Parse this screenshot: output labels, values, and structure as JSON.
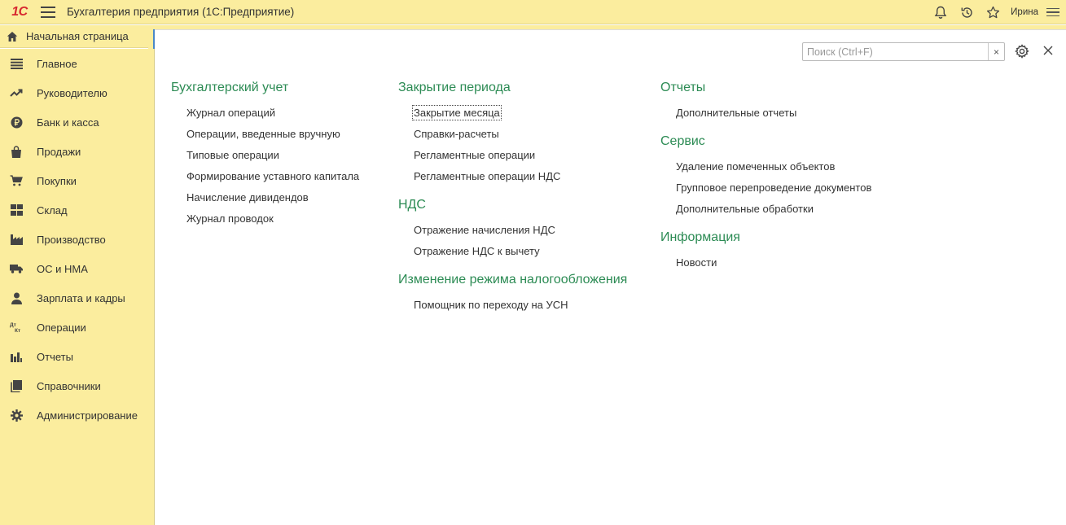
{
  "app": {
    "logo": "1С",
    "title": "Бухгалтерия предприятия  (1С:Предприятие)",
    "user": "Ирина"
  },
  "home_tab": {
    "label": "Начальная страница"
  },
  "sidebar": {
    "items": [
      {
        "label": "Главное",
        "icon": "list-icon"
      },
      {
        "label": "Руководителю",
        "icon": "trend-icon"
      },
      {
        "label": "Банк и касса",
        "icon": "ruble-coin-icon"
      },
      {
        "label": "Продажи",
        "icon": "shopping-bag-icon"
      },
      {
        "label": "Покупки",
        "icon": "cart-icon"
      },
      {
        "label": "Склад",
        "icon": "warehouse-grid-icon"
      },
      {
        "label": "Производство",
        "icon": "factory-icon"
      },
      {
        "label": "ОС и НМА",
        "icon": "truck-icon"
      },
      {
        "label": "Зарплата и кадры",
        "icon": "person-icon"
      },
      {
        "label": "Операции",
        "icon": "dt-kt-icon"
      },
      {
        "label": "Отчеты",
        "icon": "bar-chart-icon"
      },
      {
        "label": "Справочники",
        "icon": "books-icon"
      },
      {
        "label": "Администрирование",
        "icon": "gear-icon"
      }
    ]
  },
  "search": {
    "placeholder": "Поиск (Ctrl+F)",
    "clear": "×"
  },
  "columns": [
    {
      "sections": [
        {
          "title": "Бухгалтерский учет",
          "links": [
            "Журнал операций",
            "Операции, введенные вручную",
            "Типовые операции",
            "Формирование уставного капитала",
            "Начисление дивидендов",
            "Журнал проводок"
          ]
        }
      ]
    },
    {
      "sections": [
        {
          "title": "Закрытие периода",
          "links": [
            "Закрытие месяца",
            "Справки-расчеты",
            "Регламентные операции",
            "Регламентные операции НДС"
          ]
        },
        {
          "title": "НДС",
          "links": [
            "Отражение начисления НДС",
            "Отражение НДС к вычету"
          ]
        },
        {
          "title": "Изменение режима налогообложения",
          "links": [
            "Помощник по переходу на УСН"
          ]
        }
      ]
    },
    {
      "sections": [
        {
          "title": "Отчеты",
          "links": [
            "Дополнительные отчеты"
          ]
        },
        {
          "title": "Сервис",
          "links": [
            "Удаление помеченных объектов",
            "Групповое перепроведение документов",
            "Дополнительные обработки"
          ]
        },
        {
          "title": "Информация",
          "links": [
            "Новости"
          ]
        }
      ]
    }
  ],
  "colors": {
    "accent_green": "#2c8b54",
    "panel_yellow": "#fbed9e",
    "logo_red": "#d7282f"
  }
}
